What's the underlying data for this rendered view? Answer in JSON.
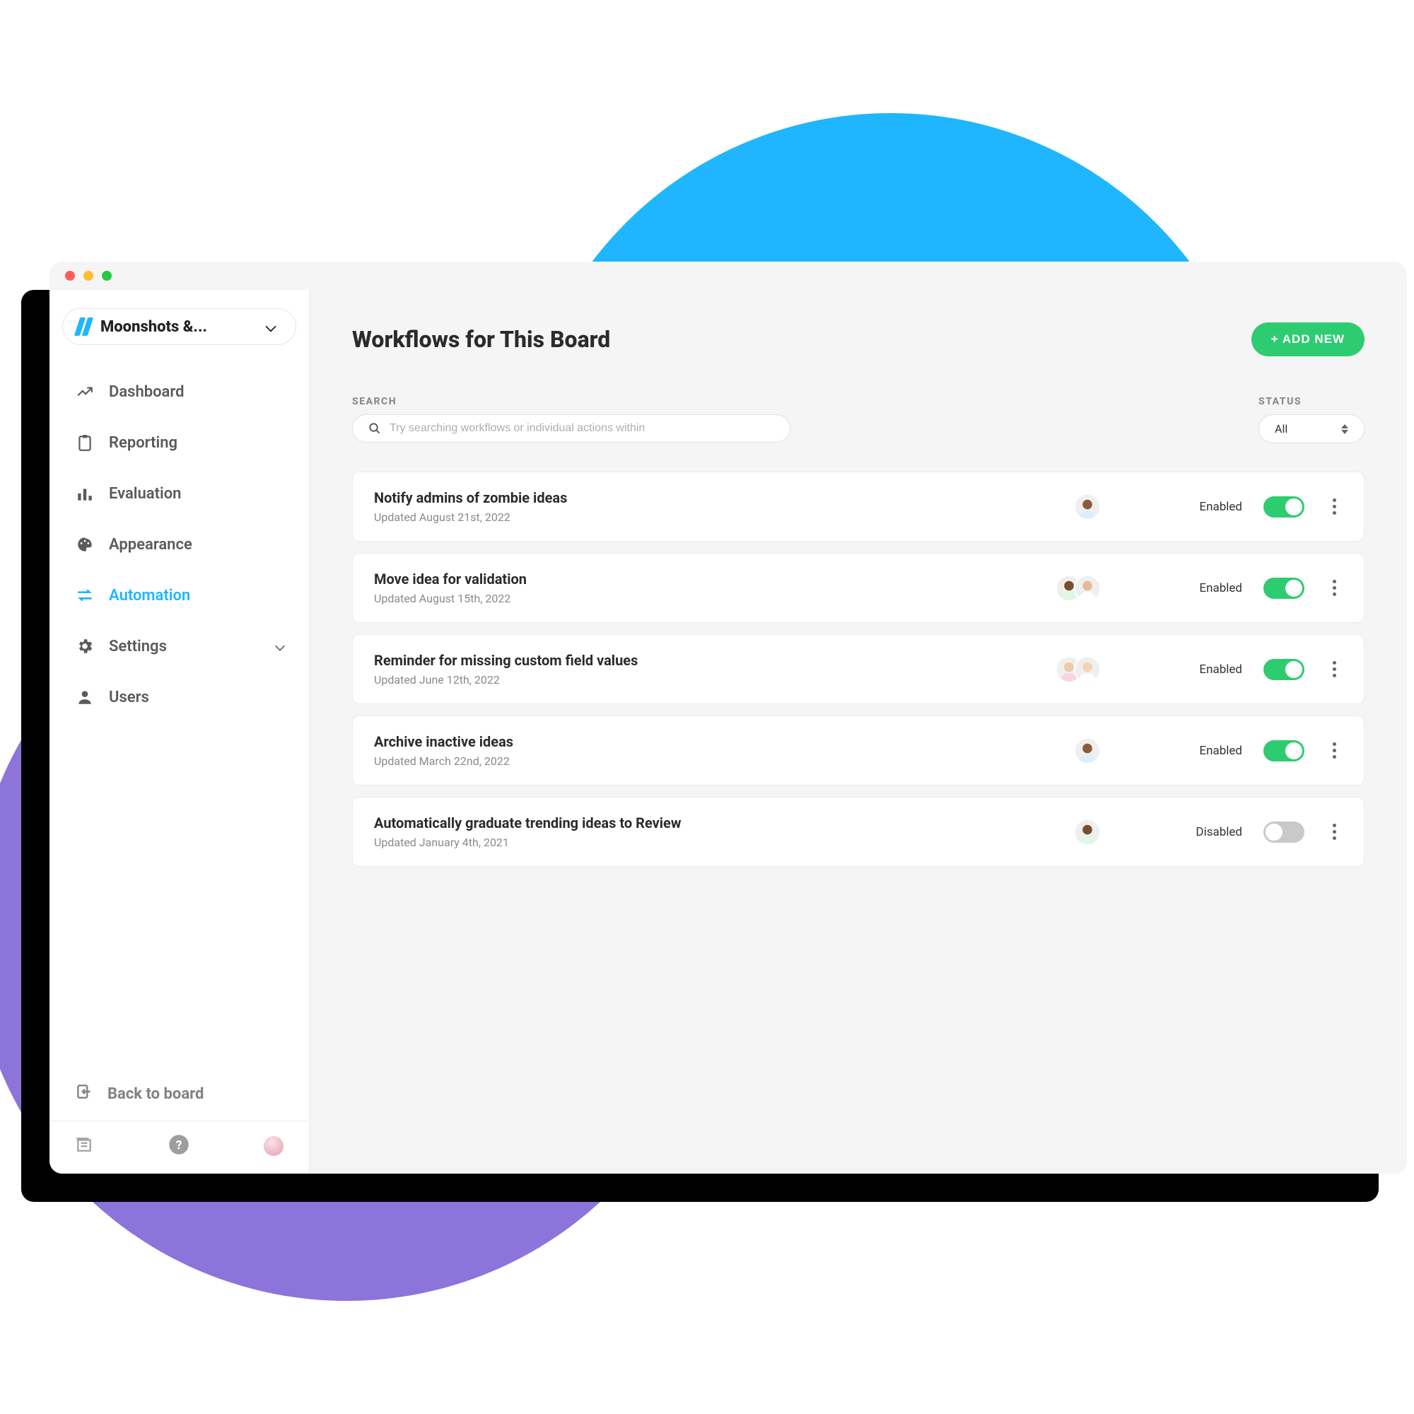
{
  "board": {
    "name": "Moonshots &..."
  },
  "sidebar": {
    "items": [
      {
        "label": "Dashboard"
      },
      {
        "label": "Reporting"
      },
      {
        "label": "Evaluation"
      },
      {
        "label": "Appearance"
      },
      {
        "label": "Automation"
      },
      {
        "label": "Settings"
      },
      {
        "label": "Users"
      }
    ],
    "back_label": "Back to board"
  },
  "main": {
    "title": "Workflows for This Board",
    "add_button": "+ ADD NEW",
    "search_label": "SEARCH",
    "search_placeholder": "Try searching workflows or individual actions within",
    "status_label": "STATUS",
    "status_value": "All"
  },
  "workflows": [
    {
      "title": "Notify admins of zombie ideas",
      "updated": "Updated August 21st, 2022",
      "status": "Enabled",
      "enabled": true,
      "avatars": 1
    },
    {
      "title": "Move idea for validation",
      "updated": "Updated August 15th, 2022",
      "status": "Enabled",
      "enabled": true,
      "avatars": 2
    },
    {
      "title": "Reminder for missing custom field values",
      "updated": "Updated June 12th, 2022",
      "status": "Enabled",
      "enabled": true,
      "avatars": 2
    },
    {
      "title": "Archive inactive ideas",
      "updated": "Updated March 22nd, 2022",
      "status": "Enabled",
      "enabled": true,
      "avatars": 1
    },
    {
      "title": "Automatically graduate trending ideas to Review",
      "updated": "Updated January 4th, 2021",
      "status": "Disabled",
      "enabled": false,
      "avatars": 1
    }
  ]
}
